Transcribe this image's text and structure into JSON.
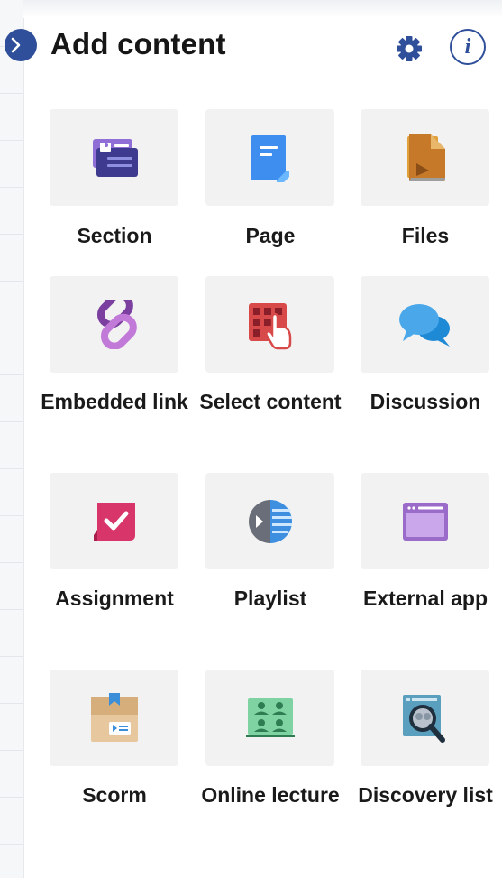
{
  "panel": {
    "title": "Add content",
    "info_symbol": "i",
    "collapse_icon": "chevron-right-icon",
    "settings_icon": "gear-icon"
  },
  "items": [
    {
      "label": "Section",
      "icon": "section-icon"
    },
    {
      "label": "Page",
      "icon": "page-icon"
    },
    {
      "label": "Files",
      "icon": "files-icon"
    },
    {
      "label": "Embedded link",
      "icon": "link-icon"
    },
    {
      "label": "Select content",
      "icon": "select-content-icon"
    },
    {
      "label": "Discussion",
      "icon": "discussion-icon"
    },
    {
      "label": "Assignment",
      "icon": "assignment-icon"
    },
    {
      "label": "Playlist",
      "icon": "playlist-icon"
    },
    {
      "label": "External app",
      "icon": "external-app-icon"
    },
    {
      "label": "Scorm",
      "icon": "scorm-icon"
    },
    {
      "label": "Online lecture",
      "icon": "online-lecture-icon"
    },
    {
      "label": "Discovery list",
      "icon": "discovery-list-icon"
    }
  ],
  "colors": {
    "accent": "#2f4f9a",
    "tile_bg": "#f2f2f2"
  }
}
